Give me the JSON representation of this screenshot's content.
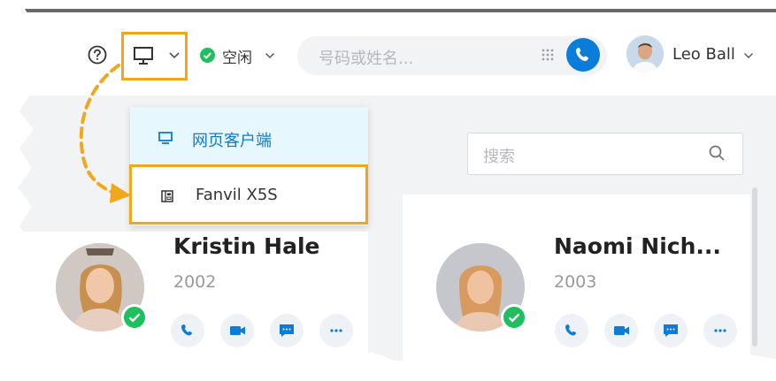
{
  "header": {
    "status_label": "空闲",
    "search_placeholder": "号码或姓名...",
    "user_name": "Leo Ball"
  },
  "device_menu": {
    "items": [
      {
        "label": "网页客户端",
        "icon": "monitor-icon",
        "selected": true
      },
      {
        "label": "Fanvil X5S",
        "icon": "desk-phone-icon",
        "selected": false
      }
    ]
  },
  "contacts_search": {
    "placeholder": "搜索"
  },
  "contacts": [
    {
      "name": "Kristin Hale",
      "extension": "2002",
      "status": "available"
    },
    {
      "name": "Naomi Nich...",
      "extension": "2003",
      "status": "available"
    }
  ],
  "colors": {
    "accent": "#0a7cd9",
    "available": "#1fbf5f",
    "highlight_border": "#f2a71a",
    "selected_row_bg": "#e6f7fd"
  }
}
